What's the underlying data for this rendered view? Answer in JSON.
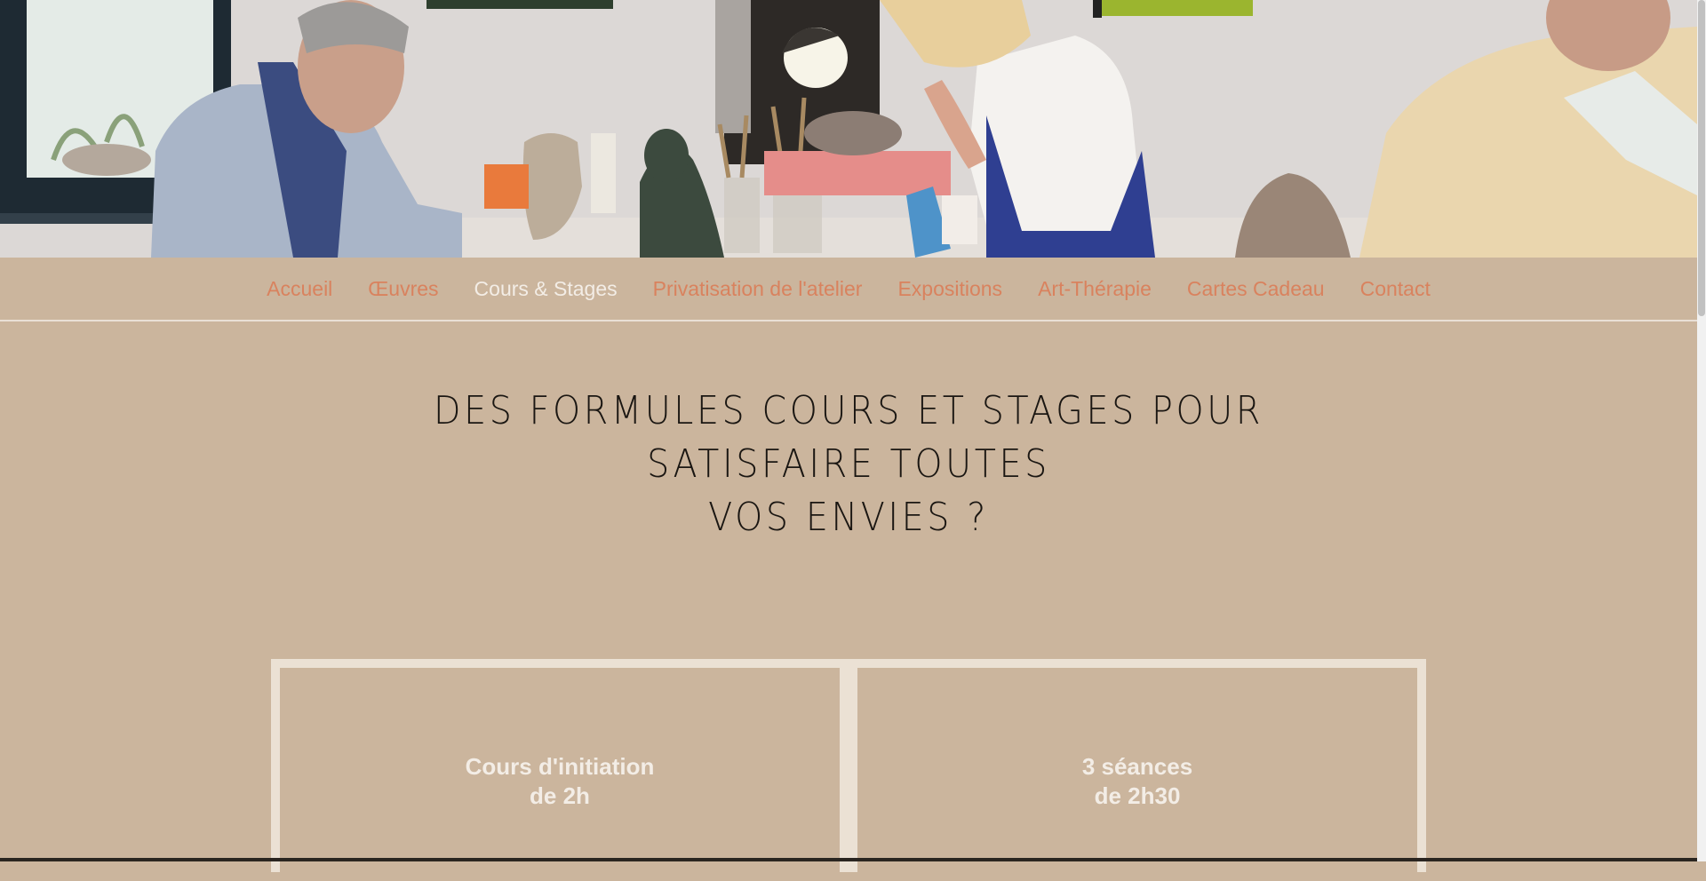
{
  "hero": {
    "icon": "atelier-photo"
  },
  "nav": {
    "items": [
      {
        "label": "Accueil"
      },
      {
        "label": "Œuvres"
      },
      {
        "label": "Cours & Stages",
        "active": true
      },
      {
        "label": "Privatisation de l'atelier"
      },
      {
        "label": "Expositions"
      },
      {
        "label": "Art-Thérapie"
      },
      {
        "label": "Cartes Cadeau"
      },
      {
        "label": "Contact"
      }
    ],
    "colors": {
      "link": "#d9825e",
      "active": "#f3ede6"
    }
  },
  "main": {
    "headline_line1": "DES FORMULES COURS ET STAGES POUR SATISFAIRE TOUTES",
    "headline_line2": "VOS ENVIES ?"
  },
  "cards": [
    {
      "line1": "Cours d'initiation",
      "line2": "de 2h"
    },
    {
      "line1": "3 séances",
      "line2": "de 2h30"
    }
  ],
  "colors": {
    "background": "#cbb59d",
    "card_border": "#ebe1d4",
    "heading": "#1a1612"
  }
}
